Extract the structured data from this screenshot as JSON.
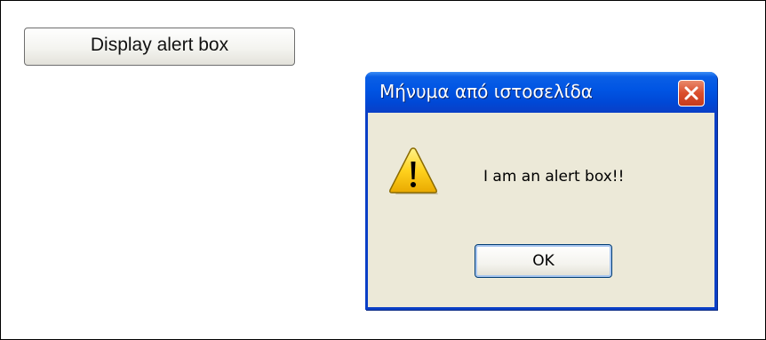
{
  "page": {
    "button_label": "Display alert box"
  },
  "dialog": {
    "title": "Μήνυμα από ιστοσελίδα",
    "message": "I am an alert box!!",
    "ok_label": "OK",
    "icons": {
      "close": "close-icon",
      "alert": "warning-icon"
    }
  },
  "colors": {
    "titlebar": "#0054e3",
    "dialog_body": "#ece9d8",
    "close_button": "#db4e2c",
    "warning_yellow": "#ffd21e"
  }
}
